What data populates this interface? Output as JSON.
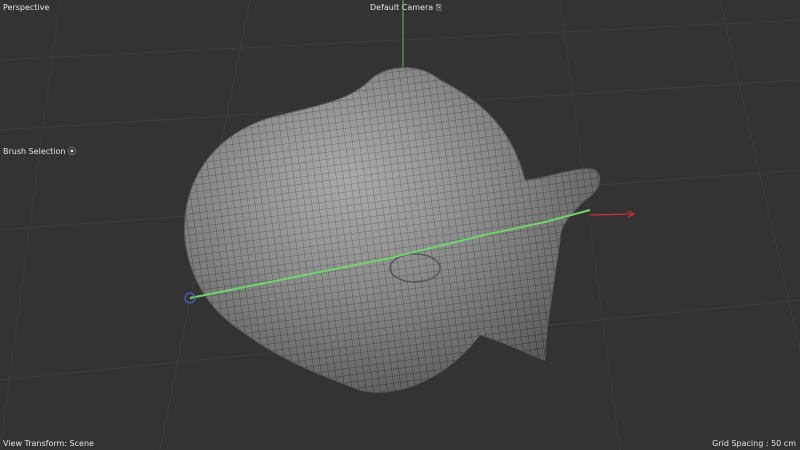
{
  "viewport": {
    "view_name": "Perspective",
    "camera_label": "Default Camera",
    "camera_icon": "camera-icon",
    "brush_selection_label": "Brush Selection",
    "brush_icon": "dot-icon",
    "view_transform": "View Transform: Scene",
    "grid_spacing": "Grid Spacing : 50 cm"
  },
  "colors": {
    "background": "#333334",
    "mesh": "#8a8a8a",
    "selection": "#6fd36a",
    "y_axis": "#3fae4a",
    "x_axis": "#c8323a"
  }
}
